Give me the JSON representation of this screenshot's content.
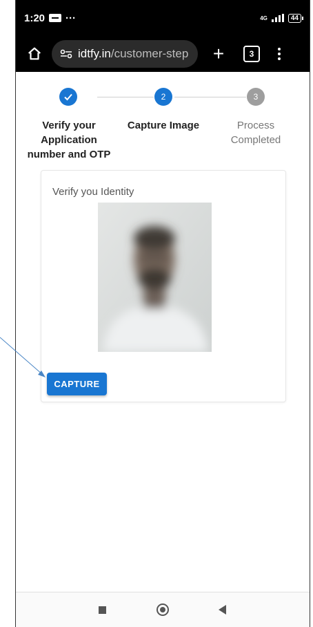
{
  "status_bar": {
    "time": "1:20",
    "dots": "···",
    "network": "4G",
    "battery": "44"
  },
  "browser": {
    "url_host": "idtfy.in",
    "url_path": "/customer-step",
    "tab_count": "3",
    "new_tab_glyph": "+"
  },
  "stepper": {
    "steps": [
      {
        "label_lines": [
          "Verify your",
          "Application",
          "number and OTP"
        ],
        "state": "completed",
        "number": ""
      },
      {
        "label_lines": [
          "Capture Image"
        ],
        "state": "active",
        "number": "2"
      },
      {
        "label_lines": [
          "Process",
          "Completed"
        ],
        "state": "pending",
        "number": "3"
      }
    ]
  },
  "card": {
    "title": "Verify you Identity",
    "capture_label": "CAPTURE"
  },
  "colors": {
    "primary": "#1976d2",
    "pending": "#9e9e9e",
    "browser_bg": "#000000",
    "pill_bg": "#2b2b2b"
  },
  "icons": {
    "home": "home-icon",
    "site_settings": "tune-icon",
    "menu": "more-vert-icon",
    "check": "check-icon"
  }
}
